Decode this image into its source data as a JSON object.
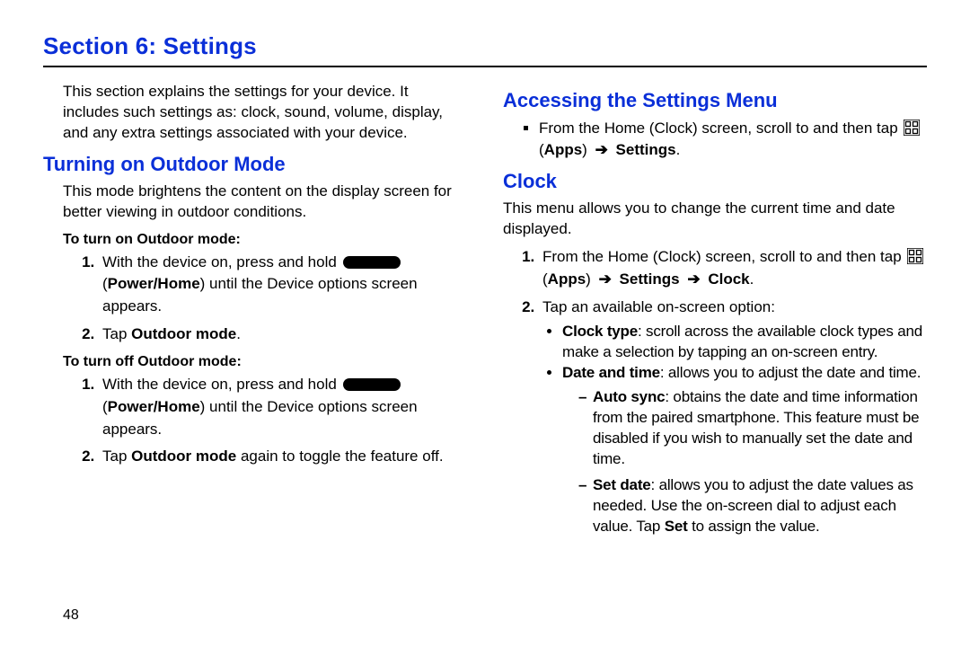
{
  "section_title": "Section 6: Settings",
  "page_number": "48",
  "left": {
    "intro": "This section explains the settings for your device. It includes such settings as: clock, sound, volume, display, and any extra settings associated with your device.",
    "h_outdoor": "Turning on Outdoor Mode",
    "outdoor_desc": "This mode brightens the content on the display screen for better viewing in outdoor conditions.",
    "to_turn_on": "To turn on Outdoor mode:",
    "on_step1_a": "With the device on, press and hold ",
    "on_step1_b": " (",
    "on_step1_c": ") until the Device options screen appears.",
    "on_step1_key": "Power/Home",
    "on_step2_a": "Tap ",
    "on_step2_b": "Outdoor mode",
    "on_step2_c": ".",
    "to_turn_off": "To turn off Outdoor mode:",
    "off_step1_a": "With the device on, press and hold ",
    "off_step1_b": " (",
    "off_step1_c": ") until the Device options screen appears.",
    "off_step1_key": "Power/Home",
    "off_step2_a": "Tap ",
    "off_step2_b": "Outdoor mode",
    "off_step2_c": " again to toggle the feature off."
  },
  "right": {
    "h_access": "Accessing the Settings Menu",
    "access_line_a": "From the Home (Clock) screen, scroll to and then tap ",
    "access_apps_a": " (",
    "access_apps_b": "Apps",
    "access_apps_c": ") ",
    "arrow": "➔",
    "access_settings": "Settings",
    "period": ".",
    "h_clock": "Clock",
    "clock_desc": "This menu allows you to change the current time and date displayed.",
    "clock_step1_a": "From the Home (Clock) screen, scroll to and then tap ",
    "clock_step1_apps_a": " (",
    "clock_step1_apps_b": "Apps",
    "clock_step1_apps_c": ") ",
    "clock_step1_settings": "Settings",
    "clock_step1_clock": "Clock",
    "clock_step2": "Tap an available on-screen option:",
    "bullet_clocktype_a": "Clock type",
    "bullet_clocktype_b": ": scroll across the available clock types and make a selection by tapping an on-screen entry.",
    "bullet_datetime_a": "Date and time",
    "bullet_datetime_b": ": allows you to adjust the date and time.",
    "dash_autosync_a": "Auto sync",
    "dash_autosync_b": ": obtains the date and time information from the paired smartphone. This feature must be disabled if you wish to manually set the date and time.",
    "dash_setdate_a": "Set date",
    "dash_setdate_b": ": allows you to adjust the date values as needed. Use the on-screen dial to adjust each value. Tap ",
    "dash_setdate_c": "Set",
    "dash_setdate_d": " to assign the value."
  }
}
